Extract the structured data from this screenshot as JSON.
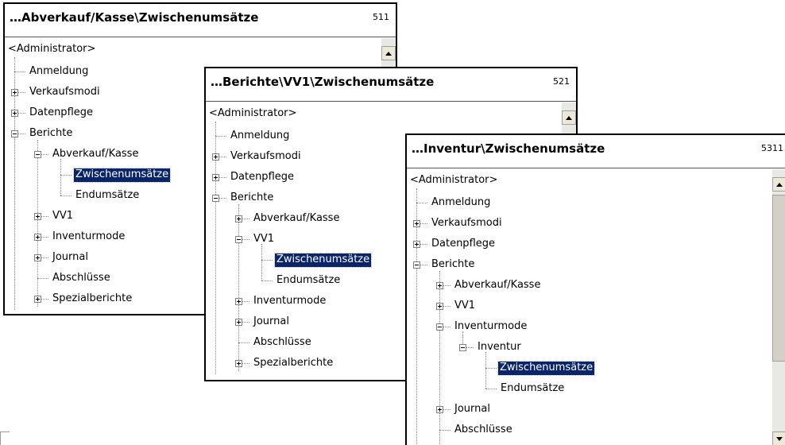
{
  "windows": [
    {
      "title": "…Abverkauf/Kasse\\Zwischenumsätze",
      "number": "511",
      "root": "<Administrator>",
      "items": [
        "Anmeldung",
        "Verkaufsmodi",
        "Datenpflege",
        "Berichte",
        "Abverkauf/Kasse",
        "Zwischenumsätze",
        "Endumsätze",
        "VV1",
        "Inventurmode",
        "Journal",
        "Abschlüsse",
        "Spezialberichte"
      ]
    },
    {
      "title": "…Berichte\\VV1\\Zwischenumsätze",
      "number": "521",
      "root": "<Administrator>",
      "items": [
        "Anmeldung",
        "Verkaufsmodi",
        "Datenpflege",
        "Berichte",
        "Abverkauf/Kasse",
        "VV1",
        "Zwischenumsätze",
        "Endumsätze",
        "Inventurmode",
        "Journal",
        "Abschlüsse",
        "Spezialberichte"
      ]
    },
    {
      "title": "…Inventur\\Zwischenumsätze",
      "number": "5311",
      "root": "<Administrator>",
      "items": [
        "Anmeldung",
        "Verkaufsmodi",
        "Datenpflege",
        "Berichte",
        "Abverkauf/Kasse",
        "VV1",
        "Inventurmode",
        "Inventur",
        "Zwischenumsätze",
        "Endumsätze",
        "Journal",
        "Abschlüsse"
      ]
    }
  ],
  "colors": {
    "selection": "#0a246a",
    "selection_text": "#ffffff",
    "border": "#000000"
  },
  "icons": {
    "expand": "plus-box-icon",
    "collapse": "minus-box-icon",
    "scroll_up": "arrow-up-icon",
    "scroll_down": "arrow-down-icon"
  }
}
